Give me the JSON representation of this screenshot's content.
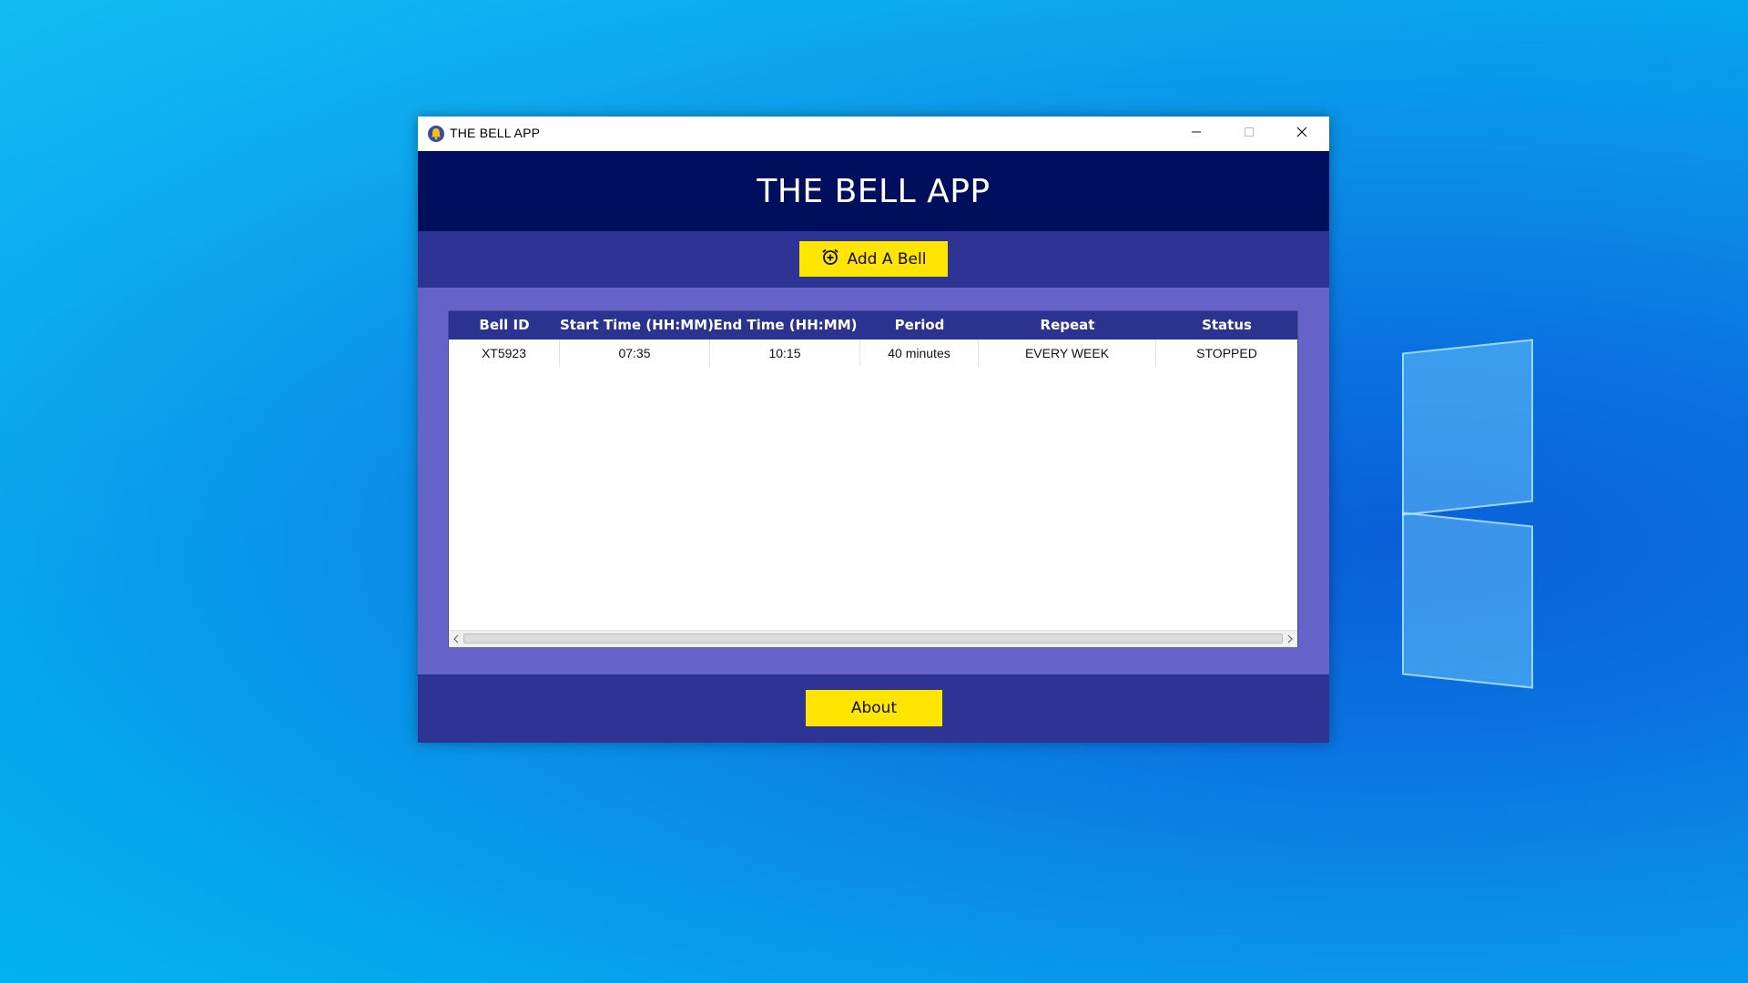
{
  "window": {
    "title": "THE BELL APP",
    "controls": {
      "minimize": "minimize",
      "maximize": "maximize",
      "close": "close"
    }
  },
  "header": {
    "title": "THE BELL APP"
  },
  "toolbar": {
    "add_label": "Add A Bell",
    "add_icon": "alarm-add-icon"
  },
  "table": {
    "columns": [
      "Bell ID",
      "Start Time (HH:MM)",
      "End Time (HH:MM)",
      "Period",
      "Repeat",
      "Status"
    ],
    "rows": [
      {
        "bell_id": "XT5923",
        "start": "07:35",
        "end": "10:15",
        "period": "40 minutes",
        "repeat": "EVERY WEEK",
        "status": "STOPPED"
      }
    ]
  },
  "footer": {
    "about_label": "About"
  },
  "colors": {
    "header": "#000e5e",
    "band": "#2d3494",
    "content": "#6663c8",
    "button": "#ffe500",
    "table_header": "#2a3390"
  }
}
